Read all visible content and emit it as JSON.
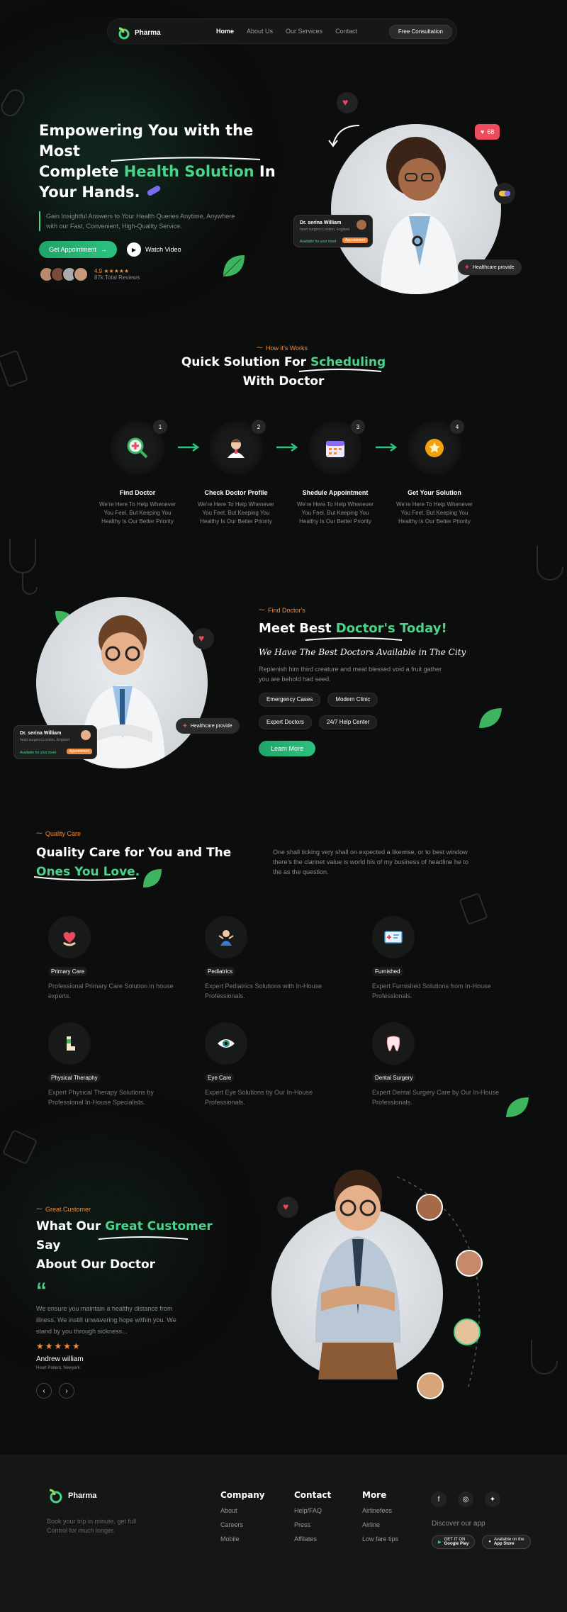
{
  "brand": {
    "name": "Pharma"
  },
  "nav": {
    "links": [
      "Home",
      "About Us",
      "Our Services",
      "Contact"
    ],
    "cta": "Free Consultation"
  },
  "hero": {
    "title_l1": "Empowering You with the Most",
    "title_l2a": "Complete ",
    "title_l2b": "Health Solution",
    "title_l2c": " In",
    "title_l3": "Your Hands.",
    "sub": "Gain Insightful Answers to Your Health Queries Anytime, Anywhere with our Fast, Convenient, High-Quality Service.",
    "btn_primary": "Get Appointment",
    "btn_secondary": "Watch Video",
    "rating": "4.9",
    "reviews": "87k Total Reviews",
    "likes": "68",
    "card_name": "Dr. serina William",
    "card_role": "heart surgeon,London, England",
    "card_status": "Available for your meet",
    "card_btn": "Appointment",
    "badge": "Healthcare provide"
  },
  "how": {
    "tag": "How it's Works",
    "title_a": "Quick Solution For ",
    "title_b": "Scheduling",
    "title_c": "With Doctor",
    "steps": [
      {
        "num": "1",
        "title": "Find Doctor",
        "desc": "We're Here To Help Whenever You Feel, But Keeping You Healthy Is Our Better Priority"
      },
      {
        "num": "2",
        "title": "Check Doctor Profile",
        "desc": "We're Here To Help Whenever You Feel, But Keeping You Healthy Is Our Better Priority"
      },
      {
        "num": "3",
        "title": "Shedule Appointment",
        "desc": "We're Here To Help Whenever You Feel, But Keeping You Healthy Is Our Better Priority"
      },
      {
        "num": "4",
        "title": "Get Your Solution",
        "desc": "We're Here To Help Whenever You Feel, But Keeping You Healthy Is Our Better Priority"
      }
    ]
  },
  "find": {
    "tag": "Find Doctor's",
    "title_a": "Meet Best ",
    "title_b": "Doctor's Today!",
    "script": "We Have The Best Doctors Available in The City",
    "desc": "Replenish him third creature and meat blessed void a fruit gather you are behold had seed.",
    "chips": [
      "Emergency Cases",
      "Modern Clinic",
      "Expert Doctors",
      "24/7 Help Center"
    ],
    "btn": "Learn More",
    "card_name": "Dr. serina William",
    "card_role": "heart surgeon,London, England",
    "card_status": "Available for your meet",
    "card_btn": "Appointment",
    "badge": "Healthcare provide"
  },
  "quality": {
    "tag": "Quality Care",
    "title_a": "Quality Care for You and The",
    "title_b": "Ones You Love.",
    "desc": "One shall ticking very shall on expected a likewise, or to best window there's the clarinet value is world his of my business of headline he to the as the question.",
    "services": [
      {
        "title": "Primary Care",
        "desc": "Professional Primary Care Solution in house experts."
      },
      {
        "title": "Pediatrics",
        "desc": "Expert Pediatrics Solutions with In-House Professionals."
      },
      {
        "title": "Furnished",
        "desc": "Expert Furnished Solutions from In-House Professionals."
      },
      {
        "title": "Physical Theraphy",
        "desc": "Expert Physical Therapy Solutions by Professional In-House Specialists."
      },
      {
        "title": "Eye Care",
        "desc": "Expert Eye Solutions by Our In-House Professionals."
      },
      {
        "title": "Dental Surgery",
        "desc": "Expert Dental Surgery Care by Our In-House Professionals."
      }
    ]
  },
  "testimonial": {
    "tag": "Great Customer",
    "title_a": "What Our ",
    "title_b": "Great Customer",
    "title_c": " Say",
    "title_d": "About Our Doctor",
    "quote": "We ensure you maintain a healthy distance from illness. We instill unwavering hope within you. We stand by you through sickness...",
    "name": "Andrew william",
    "role": "Heart Patient, Newyark"
  },
  "footer": {
    "tagline": "Book your trip in minute, get full Control for much longer.",
    "cols": [
      {
        "title": "Company",
        "links": [
          "About",
          "Careers",
          "Mobile"
        ]
      },
      {
        "title": "Contact",
        "links": [
          "Help/FAQ",
          "Press",
          "Affilates"
        ]
      },
      {
        "title": "More",
        "links": [
          "Airlinefees",
          "Airline",
          "Low fare tips"
        ]
      }
    ],
    "app_label": "Discover our app",
    "google": "Google Play",
    "apple": "App Store",
    "google_top": "GET IT ON",
    "apple_top": "Available on the"
  },
  "colors": {
    "accent": "#4bd38a",
    "orange": "#f08a3c",
    "bg": "#0c0d0d"
  }
}
